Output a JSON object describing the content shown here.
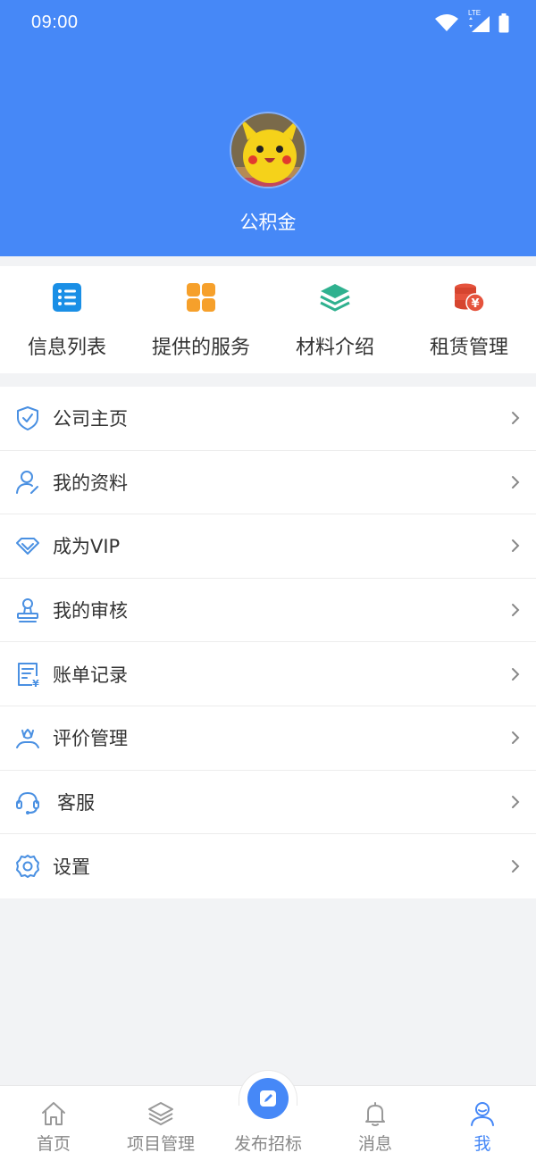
{
  "status_bar": {
    "time": "09:00",
    "network": "LTE"
  },
  "profile": {
    "name": "公积金"
  },
  "quick_grid": [
    {
      "label": "信息列表",
      "icon": "list-icon",
      "color": "#1a8fe6"
    },
    {
      "label": "提供的服务",
      "icon": "apps-grid-icon",
      "color": "#f6a02b"
    },
    {
      "label": "材料介绍",
      "icon": "layers-icon",
      "color": "#2fb18f"
    },
    {
      "label": "租赁管理",
      "icon": "coin-stack-icon",
      "color": "#e5533d"
    }
  ],
  "menu": [
    {
      "label": "公司主页",
      "icon": "shield-check-icon"
    },
    {
      "label": "我的资料",
      "icon": "user-edit-icon"
    },
    {
      "label": "成为VIP",
      "icon": "diamond-icon"
    },
    {
      "label": "我的审核",
      "icon": "stamp-icon"
    },
    {
      "label": "账单记录",
      "icon": "bill-icon"
    },
    {
      "label": "评价管理",
      "icon": "flower-hand-icon"
    },
    {
      "label": "客服",
      "icon": "headset-icon"
    },
    {
      "label": "设置",
      "icon": "gear-icon"
    }
  ],
  "tabbar": [
    {
      "label": "首页",
      "icon": "home-icon"
    },
    {
      "label": "项目管理",
      "icon": "layers-icon"
    },
    {
      "label": "发布招标",
      "icon": "edit-icon"
    },
    {
      "label": "消息",
      "icon": "bell-icon"
    },
    {
      "label": "我",
      "icon": "user-icon",
      "active": true
    }
  ],
  "colors": {
    "header": "#4688f7",
    "accent": "#4688f7",
    "icon_blue": "#4a90e2",
    "background": "#f2f3f5"
  }
}
